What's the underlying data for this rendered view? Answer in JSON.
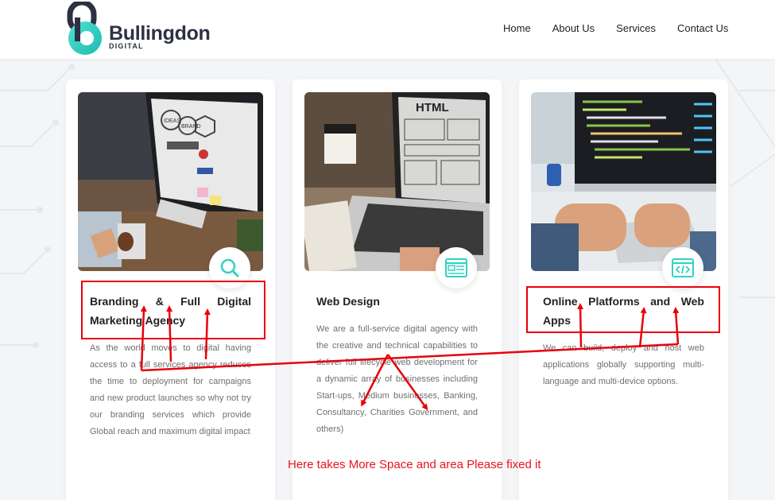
{
  "brand": {
    "name": "Bullingdon",
    "sub": "DIGITAL",
    "colors": {
      "teal": "#2ed3c2",
      "navy": "#2d3142"
    }
  },
  "nav": {
    "items": [
      {
        "label": "Home"
      },
      {
        "label": "About Us"
      },
      {
        "label": "Services"
      },
      {
        "label": "Contact Us"
      }
    ]
  },
  "cards": [
    {
      "title": "Branding & Full Digital Marketing Agency",
      "body": "As the world moves to digital having access to a full services agency reduces the time to deployment for campaigns and new product launches so why not try our branding services which provide Global reach and maximum digital impact",
      "icon": "search-icon",
      "image": "designer-desk-photo",
      "image_labels": [
        "IDEAS",
        "BRAND"
      ]
    },
    {
      "title": "Web Design",
      "body": "We are a full-service digital agency with the creative and technical capabilities to deliver full lifecycle web development for a dynamic array of businesses including Start-ups, Medium businesses, Banking, Consultancy, Charities Government, and others)",
      "icon": "web-layout-icon",
      "image": "laptop-wireframe-photo",
      "image_labels": [
        "HTML"
      ]
    },
    {
      "title": "Online Platforms and Web Apps",
      "body": "We can build, deploy and host web applications globally supporting multi-language and multi-device options.",
      "icon": "code-window-icon",
      "image": "coding-monitor-photo"
    }
  ],
  "annotation": {
    "note": "Here takes More Space and area Please fixed it",
    "color": "#e8000b"
  }
}
